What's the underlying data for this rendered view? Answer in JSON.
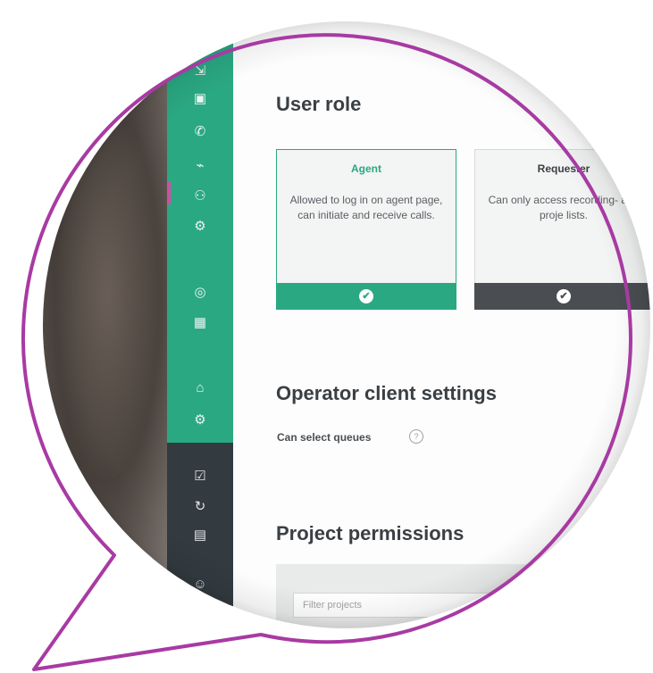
{
  "colors": {
    "accent": "#2aa882",
    "dark_bar": "#4a4e52",
    "bubble_outline": "#a83aa3",
    "active_marker": "#d04fa5"
  },
  "sidebar": {
    "green_icons": [
      "arrow-icon",
      "calendar-icon",
      "phone-icon",
      "chart-icon",
      "agents-icon",
      "settings-sliders-icon",
      "sound-icon",
      "table-icon",
      "inbox-icon",
      "gear-icon"
    ],
    "dark_icons": [
      "check-list-icon",
      "refresh-icon",
      "report-icon",
      "user-icon"
    ]
  },
  "user_role": {
    "title": "User role",
    "cards": [
      {
        "title": "Agent",
        "description": "Allowed to log in on agent page, can initiate and receive calls.",
        "selected": true
      },
      {
        "title": "Requester",
        "description": "Can only access recording- and proje lists.",
        "selected": true
      }
    ]
  },
  "operator_settings": {
    "title": "Operator client settings",
    "can_select_queues_label": "Can select queues",
    "info_glyph": "?"
  },
  "project_permissions": {
    "title": "Project permissions",
    "filter_placeholder": "Filter projects"
  },
  "icons": {
    "check": "✔"
  }
}
